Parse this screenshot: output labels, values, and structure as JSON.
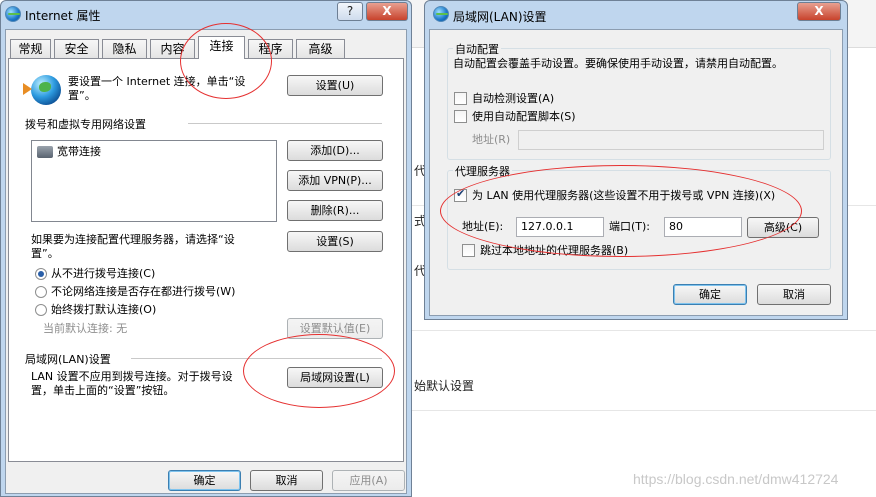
{
  "background": {
    "fragments": [
      "代",
      "式",
      "代",
      "始默认设置"
    ],
    "watermark": "https://blog.csdn.net/dmw412724"
  },
  "inet_window": {
    "title": "Internet 属性",
    "help_label": "?",
    "close_label": "X",
    "tabs": [
      {
        "label": "常规"
      },
      {
        "label": "安全"
      },
      {
        "label": "隐私"
      },
      {
        "label": "内容"
      },
      {
        "label": "连接"
      },
      {
        "label": "程序"
      },
      {
        "label": "高级"
      }
    ],
    "setup_text_1": "要设置一个 Internet 连接，单击“设",
    "setup_text_2": "置”。",
    "setup_button": "设置(U)",
    "dialup_group": "拨号和虚拟专用网络设置",
    "dialup_item": "宽带连接",
    "add_button": "添加(D)...",
    "add_vpn_button": "添加 VPN(P)...",
    "remove_button": "删除(R)...",
    "proxy_text_1": "如果要为连接配置代理服务器，请选择“设",
    "proxy_text_2": "置”。",
    "settings_button": "设置(S)",
    "radio_never": "从不进行拨号连接(C)",
    "radio_whenever": "不论网络连接是否存在都进行拨号(W)",
    "radio_always": "始终拨打默认连接(O)",
    "current_default": "当前默认连接:  无",
    "set_default_button": "设置默认值(E)",
    "lan_group": "局域网(LAN)设置",
    "lan_text_1": "LAN 设置不应用到拨号连接。对于拨号设",
    "lan_text_2": "置，单击上面的“设置”按钮。",
    "lan_settings_button": "局域网设置(L)",
    "ok_button": "确定",
    "cancel_button": "取消",
    "apply_button": "应用(A)"
  },
  "lan_window": {
    "title": "局域网(LAN)设置",
    "close_label": "X",
    "auto_group": "自动配置",
    "auto_desc": "自动配置会覆盖手动设置。要确保使用手动设置，请禁用自动配置。",
    "auto_detect": "自动检测设置(A)",
    "auto_script": "使用自动配置脚本(S)",
    "address_label_disabled": "地址(R)",
    "proxy_group": "代理服务器",
    "use_proxy": "为 LAN 使用代理服务器(这些设置不用于拨号或 VPN 连接)(X)",
    "address_label": "地址(E):",
    "address_value": "127.0.0.1",
    "port_label": "端口(T):",
    "port_value": "80",
    "advanced_button": "高级(C)",
    "bypass_local": "跳过本地地址的代理服务器(B)",
    "ok_button": "确定",
    "cancel_button": "取消"
  },
  "colors": {
    "annotation": "#e53030",
    "frame": "#bfd6ee",
    "dialog_bg": "#f0f0f0"
  }
}
